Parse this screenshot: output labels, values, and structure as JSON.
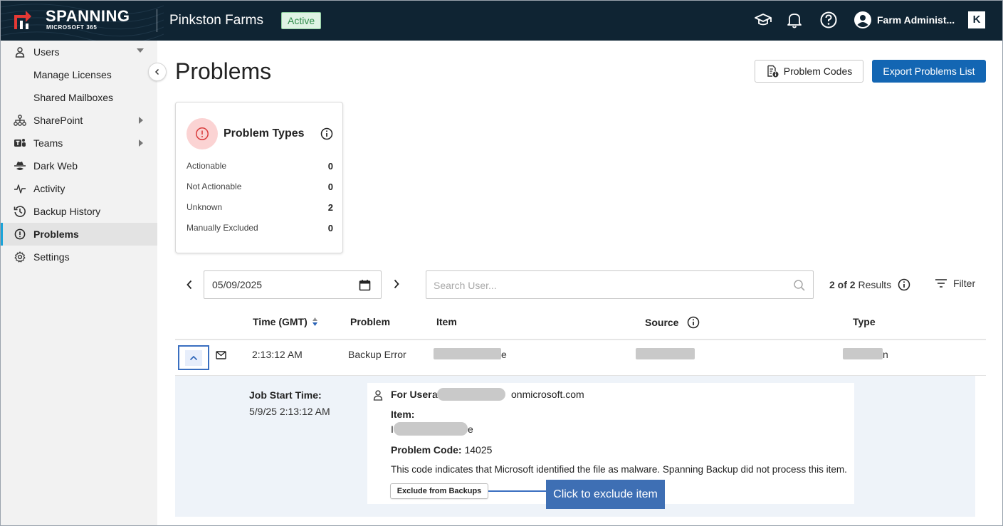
{
  "brand": {
    "name": "SPANNING",
    "sub": "MICROSOFT 365"
  },
  "header": {
    "org_name": "Pinkston Farms",
    "status_badge": "Active",
    "user_name": "Farm Administ...",
    "k_logo": "K",
    "icons": [
      "graduation-cap-icon",
      "bell-icon",
      "help-icon",
      "user-avatar-icon"
    ]
  },
  "sidebar": {
    "items": [
      {
        "label": "Users",
        "icon": "user-icon",
        "caret": "down"
      },
      {
        "label": "Manage Licenses",
        "sub": true
      },
      {
        "label": "Shared Mailboxes",
        "sub": true
      },
      {
        "label": "SharePoint",
        "icon": "sharepoint-icon",
        "caret": "right"
      },
      {
        "label": "Teams",
        "icon": "teams-icon",
        "caret": "right"
      },
      {
        "label": "Dark Web",
        "icon": "spy-icon"
      },
      {
        "label": "Activity",
        "icon": "activity-icon"
      },
      {
        "label": "Backup History",
        "icon": "history-icon"
      },
      {
        "label": "Problems",
        "icon": "alert-circle-icon",
        "active": true
      },
      {
        "label": "Settings",
        "icon": "gear-icon"
      }
    ]
  },
  "main": {
    "title": "Problems",
    "problem_codes_label": "Problem Codes",
    "export_label": "Export Problems List"
  },
  "problem_types": {
    "title": "Problem Types",
    "rows": [
      {
        "label": "Actionable",
        "value": "0"
      },
      {
        "label": "Not Actionable",
        "value": "0"
      },
      {
        "label": "Unknown",
        "value": "2"
      },
      {
        "label": "Manually Excluded",
        "value": "0"
      }
    ]
  },
  "filters": {
    "date": "05/09/2025",
    "search_placeholder": "Search User...",
    "results_count": "2 of 2",
    "results_label": "Results",
    "filter_label": "Filter"
  },
  "table": {
    "headers": {
      "time": "Time (GMT)",
      "problem": "Problem",
      "item": "Item",
      "source": "Source",
      "type": "Type"
    },
    "row": {
      "time": "2:13:12 AM",
      "problem": "Backup Error",
      "item_tail": "e",
      "type_tail": "n"
    }
  },
  "detail": {
    "job_start_label": "Job Start Time:",
    "job_start_value": "5/9/25 2:13:12 AM",
    "for_user_label": "For User:",
    "for_user_head": "a",
    "for_user_tail": "onmicrosoft.com",
    "item_label": "Item:",
    "item_head": "I",
    "item_tail": "e",
    "problem_code_label": "Problem Code:",
    "problem_code_value": "14025",
    "description": "This code indicates that Microsoft identified the file as malware. Spanning Backup did not process this item.",
    "exclude_label": "Exclude from Backups",
    "callout": "Click to exclude item"
  }
}
